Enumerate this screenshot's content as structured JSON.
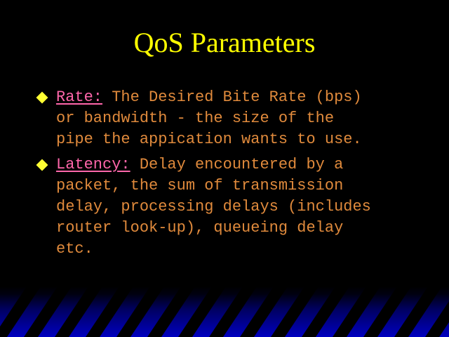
{
  "slide": {
    "title": "QoS Parameters",
    "bullets": [
      {
        "label": "Rate:",
        "lines": [
          " The Desired Bite Rate (bps)",
          "or bandwidth - the size of the",
          "pipe the appication wants to use."
        ]
      },
      {
        "label": "Latency:",
        "lines": [
          " Delay encountered by a",
          "packet, the sum of transmission",
          "delay, processing delays (includes",
          "router look-up), queueing delay",
          "etc."
        ]
      }
    ]
  },
  "colors": {
    "background": "#000000",
    "title": "#ffff00",
    "body_text": "#e08a3c",
    "label": "#ff66aa",
    "bullet_marker": "#ffff33",
    "stripe_blue": "#0000c0"
  }
}
